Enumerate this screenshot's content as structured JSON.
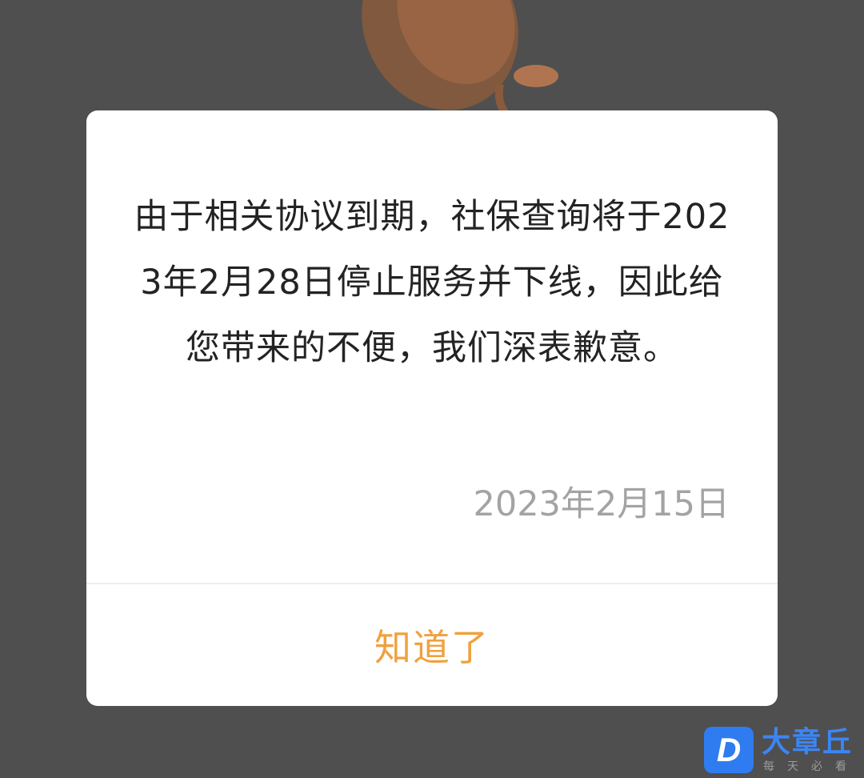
{
  "dialog": {
    "message": "由于相关协议到期，社保查询将于2023年2月28日停止服务并下线，因此给您带来的不便，我们深表歉意。",
    "date": "2023年2月15日",
    "ok_label": "知道了"
  },
  "watermark": {
    "badge": "D",
    "title": "大章丘",
    "subtitle": "每天必看"
  },
  "colors": {
    "overlay": "#4f4f4f",
    "dialog_bg": "#ffffff",
    "message_text": "#232323",
    "date_text": "#a3a3a3",
    "accent": "#f0a13e",
    "watermark_blue": "#3b86f5"
  },
  "icons": {
    "background_art": "orange-dish-illustration"
  }
}
